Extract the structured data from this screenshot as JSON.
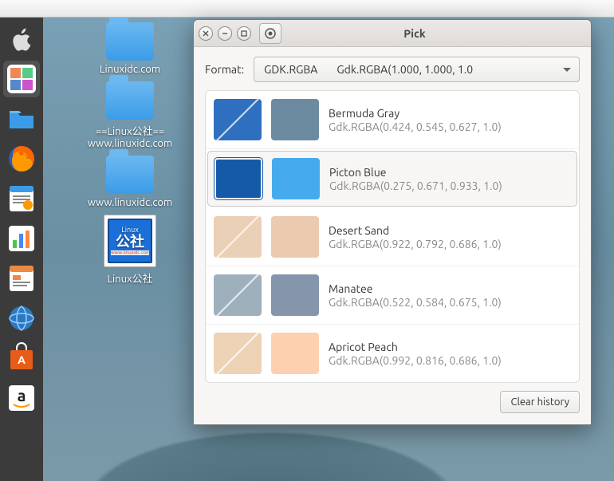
{
  "window": {
    "title": "Pick",
    "format_label": "Format:",
    "dropdown": {
      "selected": "GDK.RGBA",
      "sample": "Gdk.RGBA(1.000, 1.000, 1.0"
    },
    "clear_history": "Clear history"
  },
  "colors": [
    {
      "name": "Bermuda Gray",
      "value": "Gdk.RGBA(0.424, 0.545, 0.627, 1.0)",
      "hex": "#6c8ba0",
      "thumb": "#2f6fbf",
      "selected": false
    },
    {
      "name": "Picton Blue",
      "value": "Gdk.RGBA(0.275, 0.671, 0.933, 1.0)",
      "hex": "#46abee",
      "thumb": "#145aa9",
      "selected": true
    },
    {
      "name": "Desert Sand",
      "value": "Gdk.RGBA(0.922, 0.792, 0.686, 1.0)",
      "hex": "#ebcaaf",
      "thumb": "#ead0b6",
      "selected": false
    },
    {
      "name": "Manatee",
      "value": "Gdk.RGBA(0.522, 0.584, 0.675, 1.0)",
      "hex": "#8595ac",
      "thumb": "#9fb0bd",
      "selected": false
    },
    {
      "name": "Apricot Peach",
      "value": "Gdk.RGBA(0.992, 0.816, 0.686, 1.0)",
      "hex": "#fdd0af",
      "thumb": "#edd2b6",
      "selected": false
    }
  ],
  "desktop_icons": [
    {
      "type": "folder",
      "label": "Linuxidc.com"
    },
    {
      "type": "folder",
      "label": "==Linux公社==\nwww.linuxidc.com"
    },
    {
      "type": "folder",
      "label": "www.linuxidc.com"
    },
    {
      "type": "launcher",
      "label": "Linux公社"
    }
  ],
  "dock": {
    "items": [
      {
        "name": "apple-icon"
      },
      {
        "name": "pick-app-icon",
        "active": true
      },
      {
        "name": "files-icon"
      },
      {
        "name": "firefox-icon"
      },
      {
        "name": "writer-icon"
      },
      {
        "name": "charts-icon"
      },
      {
        "name": "impress-icon"
      },
      {
        "name": "globe-icon"
      },
      {
        "name": "software-center-icon"
      },
      {
        "name": "amazon-icon"
      }
    ]
  }
}
